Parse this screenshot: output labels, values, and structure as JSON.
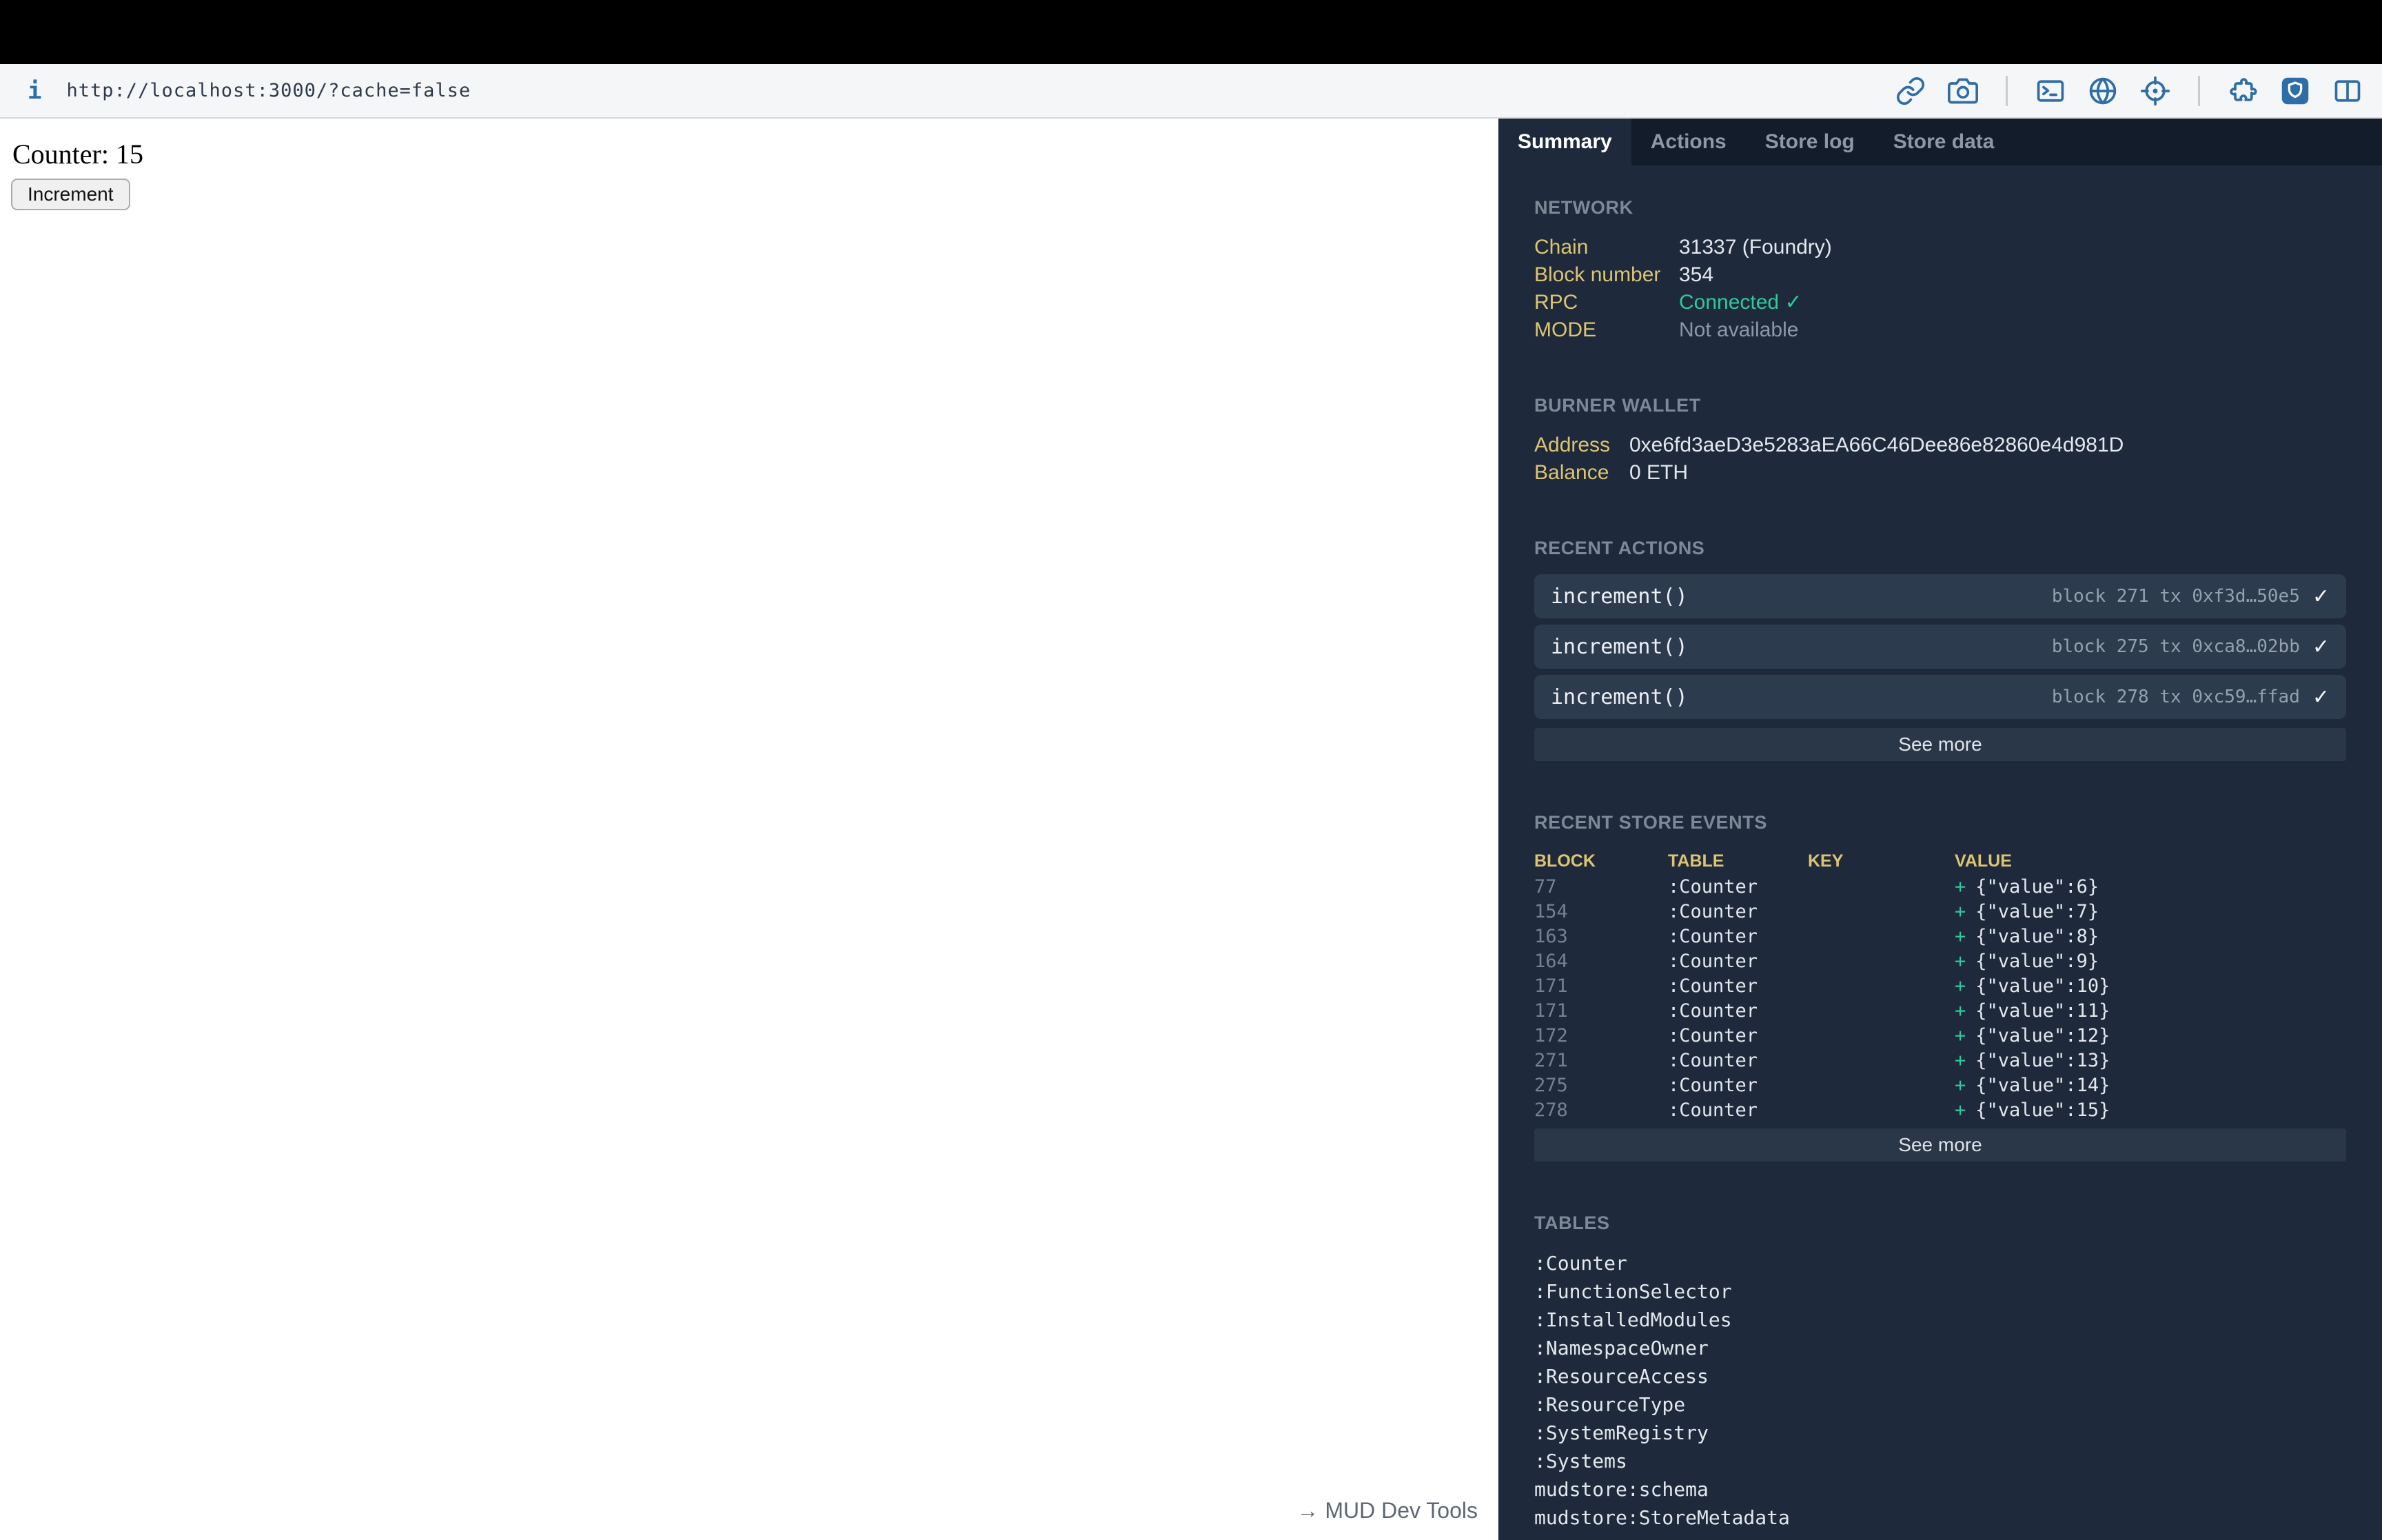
{
  "browser": {
    "url": "http://localhost:3000/?cache=false",
    "info_icon": "i",
    "toolbar_icons": [
      "link-icon",
      "camera-icon",
      "terminal-icon",
      "globe-icon",
      "crosshair-icon",
      "puzzle-icon",
      "shield-icon",
      "split-columns-icon"
    ],
    "icon_color": "#2e6da6"
  },
  "page": {
    "counter_text": "Counter: 15",
    "increment_button": "Increment",
    "devtools_toggle": "→ MUD Dev Tools"
  },
  "panel": {
    "tabs": [
      {
        "label": "Summary",
        "active": true
      },
      {
        "label": "Actions",
        "active": false
      },
      {
        "label": "Store log",
        "active": false
      },
      {
        "label": "Store data",
        "active": false
      }
    ],
    "network": {
      "title": "NETWORK",
      "rows": [
        {
          "label": "Chain",
          "value": "31337 (Foundry)"
        },
        {
          "label": "Block number",
          "value": "354"
        },
        {
          "label": "RPC",
          "value": "Connected ✓"
        },
        {
          "label": "MODE",
          "value": "Not available"
        }
      ]
    },
    "burner_wallet": {
      "title": "BURNER WALLET",
      "rows": [
        {
          "label": "Address",
          "value": "0xe6fd3aeD3e5283aEA66C46Dee86e82860e4d981D"
        },
        {
          "label": "Balance",
          "value": "0 ETH"
        }
      ]
    },
    "recent_actions": {
      "title": "RECENT ACTIONS",
      "check": "✓",
      "items": [
        {
          "name": "increment()",
          "meta": "block 271 tx 0xf3d…50e5"
        },
        {
          "name": "increment()",
          "meta": "block 275 tx 0xca8…02bb"
        },
        {
          "name": "increment()",
          "meta": "block 278 tx 0xc59…ffad"
        }
      ],
      "see_more": "See more"
    },
    "store_events": {
      "title": "RECENT STORE EVENTS",
      "columns": [
        "BLOCK",
        "TABLE",
        "KEY",
        "VALUE"
      ],
      "plus": "+",
      "rows": [
        {
          "block": "77",
          "table": ":Counter",
          "key": "",
          "value": "{\"value\":6}"
        },
        {
          "block": "154",
          "table": ":Counter",
          "key": "",
          "value": "{\"value\":7}"
        },
        {
          "block": "163",
          "table": ":Counter",
          "key": "",
          "value": "{\"value\":8}"
        },
        {
          "block": "164",
          "table": ":Counter",
          "key": "",
          "value": "{\"value\":9}"
        },
        {
          "block": "171",
          "table": ":Counter",
          "key": "",
          "value": "{\"value\":10}"
        },
        {
          "block": "171",
          "table": ":Counter",
          "key": "",
          "value": "{\"value\":11}"
        },
        {
          "block": "172",
          "table": ":Counter",
          "key": "",
          "value": "{\"value\":12}"
        },
        {
          "block": "271",
          "table": ":Counter",
          "key": "",
          "value": "{\"value\":13}"
        },
        {
          "block": "275",
          "table": ":Counter",
          "key": "",
          "value": "{\"value\":14}"
        },
        {
          "block": "278",
          "table": ":Counter",
          "key": "",
          "value": "{\"value\":15}"
        }
      ],
      "see_more": "See more"
    },
    "tables": {
      "title": "TABLES",
      "items": [
        ":Counter",
        ":FunctionSelector",
        ":InstalledModules",
        ":NamespaceOwner",
        ":ResourceAccess",
        ":ResourceType",
        ":SystemRegistry",
        ":Systems",
        "mudstore:schema",
        "mudstore:StoreMetadata"
      ]
    }
  },
  "colors": {
    "panel_bg": "#1e2a3b",
    "tabbar_bg": "#121c2b",
    "row_bg": "#2d3b4f",
    "label_yellow": "#dcc472",
    "success_green": "#31c79c",
    "toolbar_blue": "#2e6da6"
  }
}
